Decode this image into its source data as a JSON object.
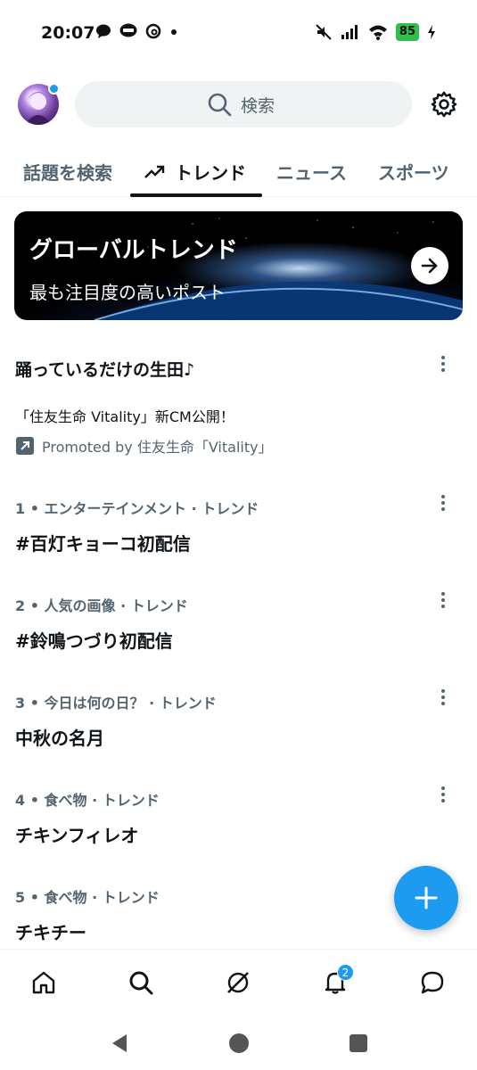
{
  "status_bar": {
    "time": "20:07",
    "battery": "85",
    "left_icons": [
      "chat-bubble-icon",
      "line-icon",
      "threads-icon",
      "dot-icon"
    ],
    "right_icons": [
      "mute-icon",
      "signal-icon",
      "wifi-icon",
      "battery-icon"
    ]
  },
  "header": {
    "search_placeholder": "検索",
    "settings_icon": "gear-icon"
  },
  "tabs": [
    {
      "label": "話題を検索",
      "active": false
    },
    {
      "label": "トレンド",
      "active": true,
      "icon": "trending-icon"
    },
    {
      "label": "ニュース",
      "active": false
    },
    {
      "label": "スポーツ",
      "active": false
    }
  ],
  "banner": {
    "title": "グローバルトレンド",
    "subtitle": "最も注目度の高いポスト",
    "icon": "arrow-right-icon"
  },
  "promoted": {
    "title": "踊っているだけの生田♪",
    "description": "「住友生命 Vitality」新CM公開！",
    "promoted_by": "Promoted by 住友生命「Vitality」"
  },
  "trends": [
    {
      "meta": "1 • エンターテインメント · トレンド",
      "name": "#百灯キョーコ初配信"
    },
    {
      "meta": "2 • 人気の画像 · トレンド",
      "name": "#鈴鳴つづり初配信"
    },
    {
      "meta": "3 • 今日は何の日？ · トレンド",
      "name": "中秋の名月"
    },
    {
      "meta": "4 • 食べ物 · トレンド",
      "name": "チキンフィレオ"
    },
    {
      "meta": "5 • 食べ物 · トレンド",
      "name": "チキチー"
    }
  ],
  "bottom_nav": {
    "items": [
      "home-icon",
      "search-icon",
      "grok-icon",
      "bell-icon",
      "messages-icon"
    ],
    "notification_count": "2"
  },
  "colors": {
    "accent": "#1d9bf0",
    "text_primary": "#0f1419",
    "text_secondary": "#536471",
    "battery": "#2ec04a"
  }
}
